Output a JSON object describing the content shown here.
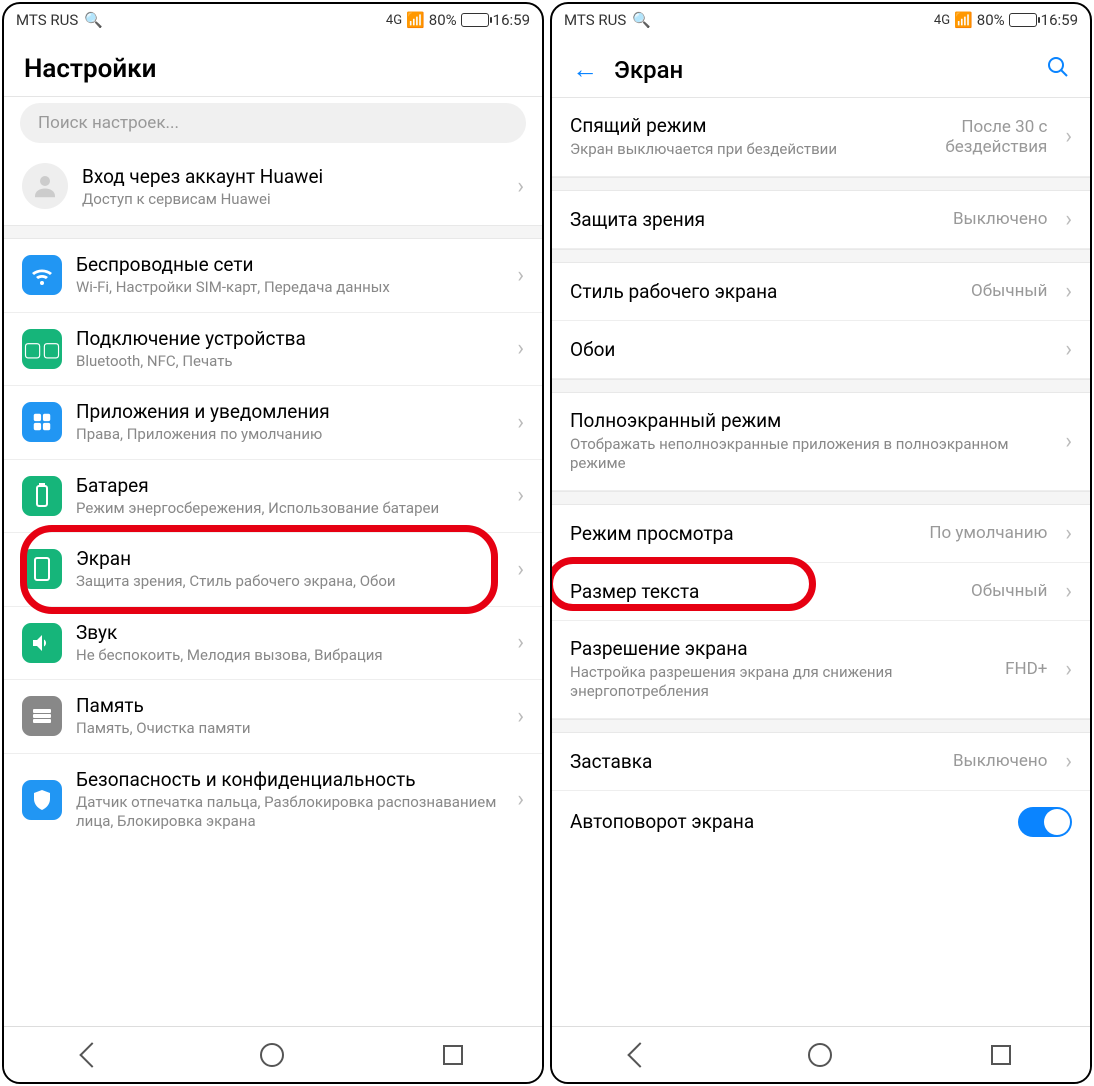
{
  "statusbar": {
    "carrier": "MTS RUS",
    "network": "4G",
    "battery_percent": "80%",
    "time": "16:59"
  },
  "left": {
    "title": "Настройки",
    "search_placeholder": "Поиск настроек...",
    "account": {
      "title": "Вход через аккаунт Huawei",
      "sub": "Доступ к сервисам Huawei"
    },
    "items": [
      {
        "title": "Беспроводные сети",
        "sub": "Wi-Fi, Настройки SIM-карт, Передача данных"
      },
      {
        "title": "Подключение устройства",
        "sub": "Bluetooth, NFC, Печать"
      },
      {
        "title": "Приложения и уведомления",
        "sub": "Права, Приложения по умолчанию"
      },
      {
        "title": "Батарея",
        "sub": "Режим энергосбережения, Использование батареи"
      },
      {
        "title": "Экран",
        "sub": "Защита зрения, Стиль рабочего экрана, Обои"
      },
      {
        "title": "Звук",
        "sub": "Не беспокоить, Мелодия вызова, Вибрация"
      },
      {
        "title": "Память",
        "sub": "Память, Очистка памяти"
      },
      {
        "title": "Безопасность и конфиденциальность",
        "sub": "Датчик отпечатка пальца, Разблокировка распознаванием лица, Блокировка экрана"
      }
    ]
  },
  "right": {
    "title": "Экран",
    "groups": {
      "a": [
        {
          "title": "Спящий режим",
          "sub": "Экран выключается при бездействии",
          "val": "После 30 с бездействия"
        }
      ],
      "b": [
        {
          "title": "Защита зрения",
          "val": "Выключено"
        }
      ],
      "c": [
        {
          "title": "Стиль рабочего экрана",
          "val": "Обычный"
        },
        {
          "title": "Обои",
          "val": ""
        }
      ],
      "d": [
        {
          "title": "Полноэкранный режим",
          "sub": "Отображать неполноэкранные приложения в полноэкранном режиме"
        }
      ],
      "e": [
        {
          "title": "Режим просмотра",
          "val": "По умолчанию"
        },
        {
          "title": "Размер текста",
          "val": "Обычный",
          "highlight": true
        },
        {
          "title": "Разрешение экрана",
          "sub": "Настройка разрешения экрана для снижения энергопотребления",
          "val": "FHD+"
        }
      ],
      "f": [
        {
          "title": "Заставка",
          "val": "Выключено"
        },
        {
          "title": "Автоповорот экрана",
          "toggle": true
        }
      ]
    }
  }
}
